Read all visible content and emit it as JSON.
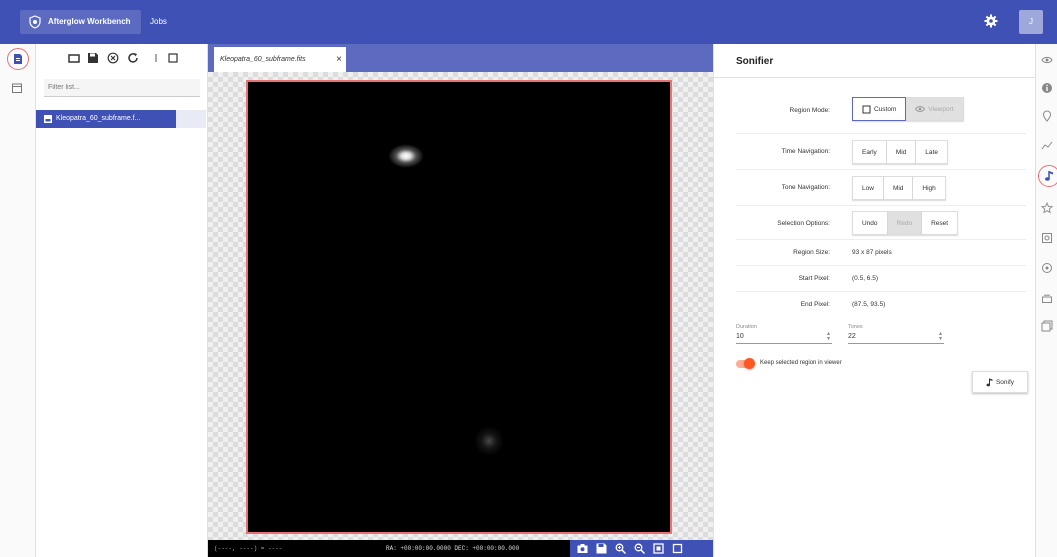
{
  "header": {
    "app_title": "Afterglow Workbench",
    "jobs_label": "Jobs",
    "user_initial": "J"
  },
  "file_panel": {
    "filter_placeholder": "Filter list...",
    "files": [
      {
        "name": "Kleopatra_60_subframe.f..."
      }
    ]
  },
  "viewer": {
    "tab_label": "Kleopatra_60_subframe.fits",
    "status": {
      "coords": "(----, ----) = ----",
      "radec": "RA: +00:00:00.0000  DEC: +00:00:00.000"
    }
  },
  "sonifier": {
    "title": "Sonifier",
    "region_mode": {
      "label": "Region Mode:",
      "options": [
        "Custom",
        "Viewport"
      ],
      "selected": "Custom"
    },
    "time_navigation": {
      "label": "Time Navigation:",
      "options": [
        "Early",
        "Mid",
        "Late"
      ]
    },
    "tone_navigation": {
      "label": "Tone Navigation:",
      "options": [
        "Low",
        "Mid",
        "High"
      ]
    },
    "selection_options": {
      "label": "Selection Options:",
      "options": [
        "Undo",
        "Redo",
        "Reset"
      ],
      "disabled": "Redo"
    },
    "region_size": {
      "label": "Region Size:",
      "value": "93 x 87 pixels"
    },
    "start_pixel": {
      "label": "Start Pixel:",
      "value": "(0.5, 6.5)"
    },
    "end_pixel": {
      "label": "End Pixel:",
      "value": "(87.5, 93.5)"
    },
    "duration": {
      "label": "Duration",
      "value": "10"
    },
    "tones": {
      "label": "Tones",
      "value": "22"
    },
    "keep_region_label": "Keep selected region in viewer",
    "keep_region_on": true,
    "sonify_label": "Sonify"
  },
  "colors": {
    "primary": "#3f51b5",
    "tab_bar": "#5c6bc0",
    "accent": "#ff5722",
    "highlight": "#e57373"
  }
}
